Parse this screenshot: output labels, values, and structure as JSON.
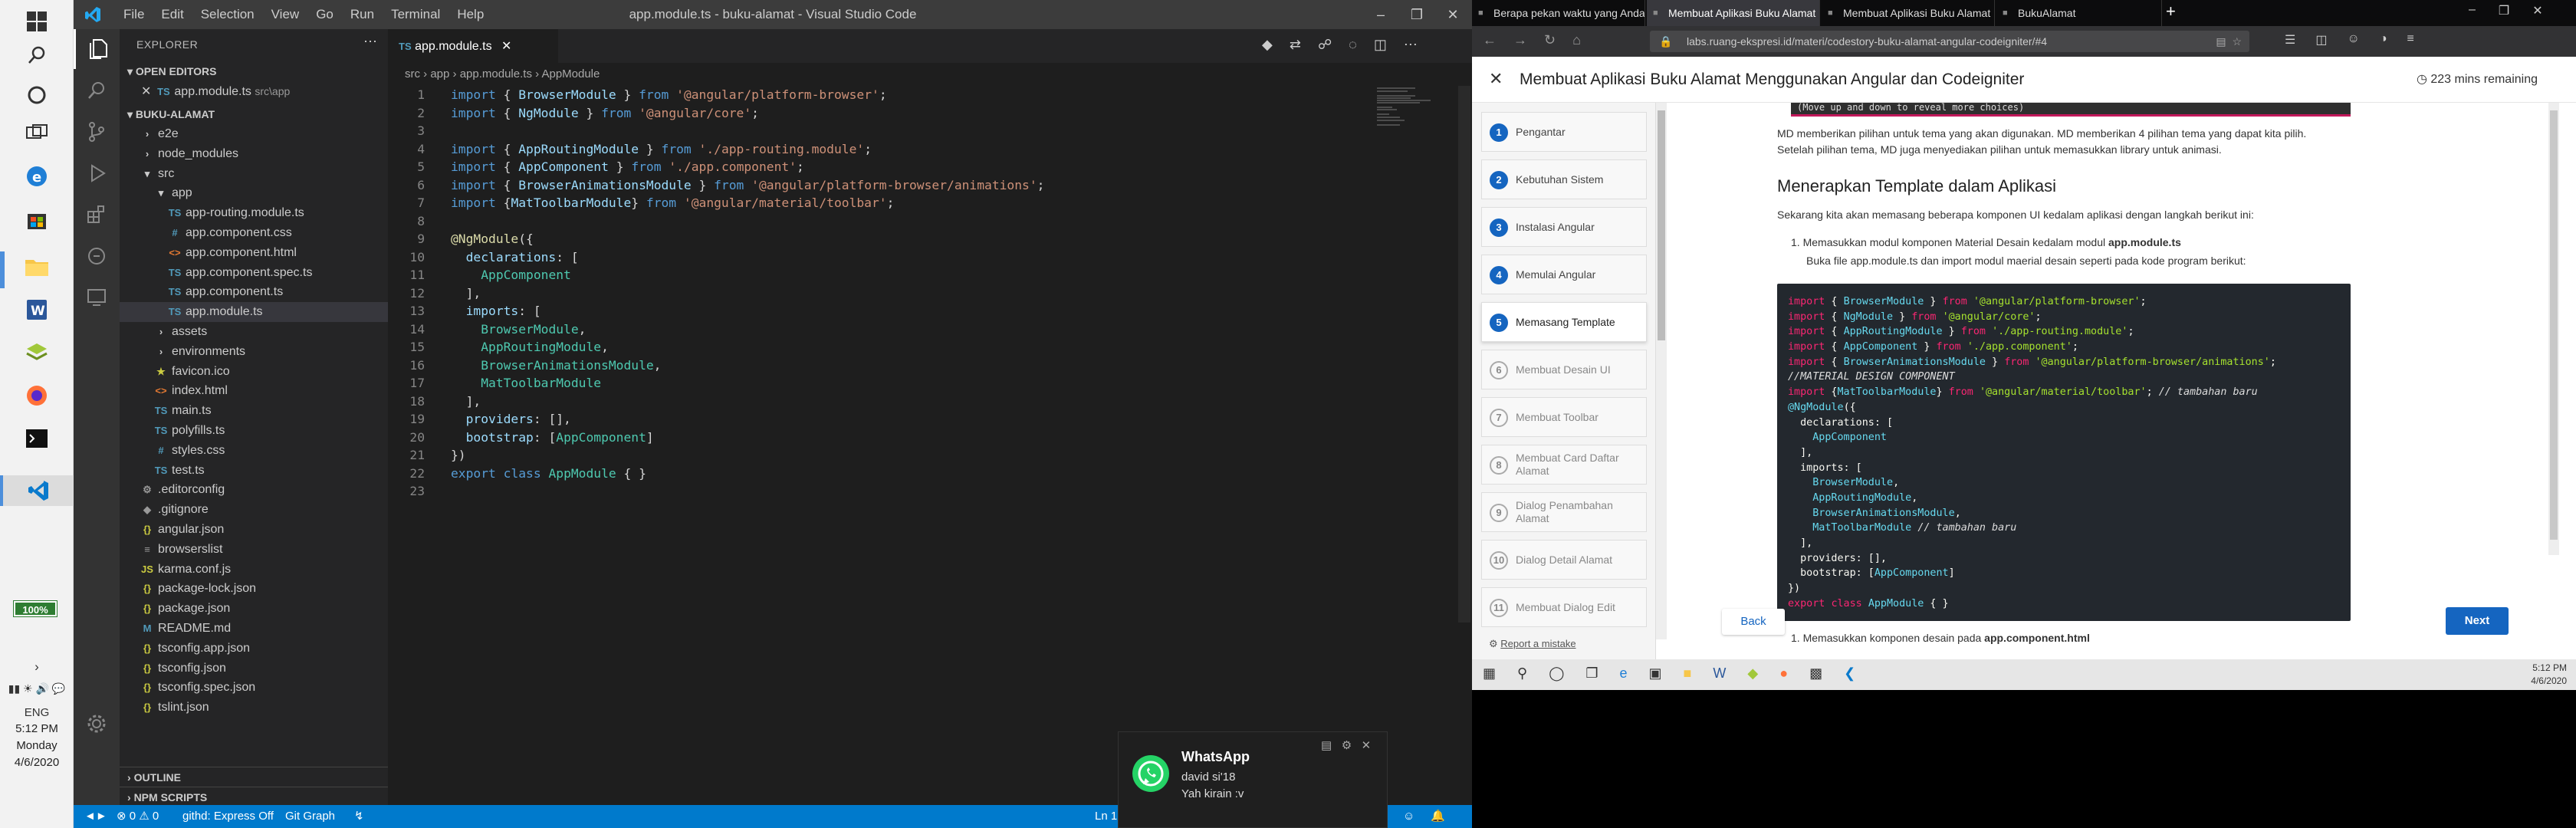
{
  "win_left_taskbar": {
    "battery": "100%",
    "lang": "ENG",
    "time": "5:12 PM",
    "day": "Monday",
    "date": "4/6/2020"
  },
  "vscode": {
    "menu": [
      "File",
      "Edit",
      "Selection",
      "View",
      "Go",
      "Run",
      "Terminal",
      "Help"
    ],
    "title": "app.module.ts - buku-alamat - Visual Studio Code",
    "explorer_label": "EXPLORER",
    "open_editors": "OPEN EDITORS",
    "open_file": "app.module.ts",
    "open_file_path": "src\\app",
    "project": "BUKU-ALAMAT",
    "tree": [
      {
        "label": "e2e",
        "type": "folder",
        "depth": 1
      },
      {
        "label": "node_modules",
        "type": "folder",
        "depth": 1
      },
      {
        "label": "src",
        "type": "folder-open",
        "depth": 1
      },
      {
        "label": "app",
        "type": "folder-open",
        "depth": 2
      },
      {
        "label": "app-routing.module.ts",
        "type": "ts",
        "depth": 3
      },
      {
        "label": "app.component.css",
        "type": "css",
        "depth": 3
      },
      {
        "label": "app.component.html",
        "type": "html",
        "depth": 3
      },
      {
        "label": "app.component.spec.ts",
        "type": "ts",
        "depth": 3
      },
      {
        "label": "app.component.ts",
        "type": "ts",
        "depth": 3
      },
      {
        "label": "app.module.ts",
        "type": "ts",
        "depth": 3
      },
      {
        "label": "assets",
        "type": "folder",
        "depth": 2
      },
      {
        "label": "environments",
        "type": "folder",
        "depth": 2
      },
      {
        "label": "favicon.ico",
        "type": "star",
        "depth": 2
      },
      {
        "label": "index.html",
        "type": "html",
        "depth": 2
      },
      {
        "label": "main.ts",
        "type": "ts",
        "depth": 2
      },
      {
        "label": "polyfills.ts",
        "type": "ts",
        "depth": 2
      },
      {
        "label": "styles.css",
        "type": "css",
        "depth": 2
      },
      {
        "label": "test.ts",
        "type": "ts",
        "depth": 2
      },
      {
        "label": ".editorconfig",
        "type": "gear",
        "depth": 1
      },
      {
        "label": ".gitignore",
        "type": "git",
        "depth": 1
      },
      {
        "label": "angular.json",
        "type": "json",
        "depth": 1
      },
      {
        "label": "browserslist",
        "type": "list",
        "depth": 1
      },
      {
        "label": "karma.conf.js",
        "type": "js",
        "depth": 1
      },
      {
        "label": "package-lock.json",
        "type": "json",
        "depth": 1
      },
      {
        "label": "package.json",
        "type": "json",
        "depth": 1
      },
      {
        "label": "README.md",
        "type": "md",
        "depth": 1
      },
      {
        "label": "tsconfig.app.json",
        "type": "json",
        "depth": 1
      },
      {
        "label": "tsconfig.json",
        "type": "json",
        "depth": 1
      },
      {
        "label": "tsconfig.spec.json",
        "type": "json",
        "depth": 1
      },
      {
        "label": "tslint.json",
        "type": "json",
        "depth": 1
      }
    ],
    "outline": "OUTLINE",
    "npm_scripts": "NPM SCRIPTS",
    "tab": "app.module.ts",
    "breadcrumb": [
      "src",
      "app",
      "app.module.ts",
      "AppModule"
    ],
    "code_lines": [
      "1",
      "2",
      "3",
      "4",
      "5",
      "6",
      "7",
      "8",
      "9",
      "10",
      "11",
      "12",
      "13",
      "14",
      "15",
      "16",
      "17",
      "18",
      "19",
      "20",
      "21",
      "22",
      "23"
    ],
    "status": {
      "errors": "0",
      "warnings": "0",
      "githd": "githd: Express Off",
      "git_graph": "Git Graph",
      "position": "Ln 1"
    }
  },
  "whatsapp": {
    "app": "WhatsApp",
    "sender": "david si'18",
    "message": "Yah kirain :v"
  },
  "browser": {
    "tabs": [
      "Berapa pekan waktu yang Anda",
      "Membuat Aplikasi Buku Alamat M",
      "Membuat Aplikasi Buku Alamat M",
      "BukuAlamat"
    ],
    "url": "labs.ruang-ekspresi.id/materi/codestory-buku-alamat-angular-codeigniter/#4",
    "url_host": "ruang-ekspresi.id",
    "page_title": "Membuat Aplikasi Buku Alamat Menggunakan Angular dan Codeigniter",
    "time_remaining": "223 mins remaining",
    "nav": [
      {
        "num": "1",
        "label": "Pengantar",
        "state": "done"
      },
      {
        "num": "2",
        "label": "Kebutuhan Sistem",
        "state": "done"
      },
      {
        "num": "3",
        "label": "Instalasi Angular",
        "state": "done"
      },
      {
        "num": "4",
        "label": "Memulai Angular",
        "state": "done"
      },
      {
        "num": "5",
        "label": "Memasang Template",
        "state": "current"
      },
      {
        "num": "6",
        "label": "Membuat Desain UI",
        "state": "todo"
      },
      {
        "num": "7",
        "label": "Membuat Toolbar",
        "state": "todo"
      },
      {
        "num": "8",
        "label": "Membuat Card Daftar Alamat",
        "state": "todo"
      },
      {
        "num": "9",
        "label": "Dialog Penambahan Alamat",
        "state": "todo"
      },
      {
        "num": "10",
        "label": "Dialog Detail Alamat",
        "state": "todo"
      },
      {
        "num": "11",
        "label": "Membuat Dialog Edit",
        "state": "todo"
      }
    ],
    "report": "Report a mistake",
    "top_snippet": "(Move up and down to reveal more choices)",
    "intro": "MD memberikan pilihan untuk tema yang akan digunakan. MD memberikan 4 pilihan tema yang dapat kita pilih. Setelah pilihan tema, MD juga menyediakan pilihan untuk memasukkan library untuk animasi.",
    "heading": "Menerapkan Template dalam Aplikasi",
    "para": "Sekarang kita akan memasang beberapa komponen UI kedalam aplikasi dengan langkah berikut ini:",
    "step1_pre": "Memasukkan modul komponen Material Desain kedalam modul ",
    "step1_bold": "app.module.ts",
    "step1_sub": "Buka file app.module.ts dan import modul maerial desain seperti pada kode program berikut:",
    "step2_pre": "Memasukkan komponen desain pada ",
    "step2_bold": "app.component.html",
    "back": "Back",
    "next": "Next"
  },
  "right_taskbar": {
    "time": "5:12 PM",
    "date": "4/6/2020"
  }
}
